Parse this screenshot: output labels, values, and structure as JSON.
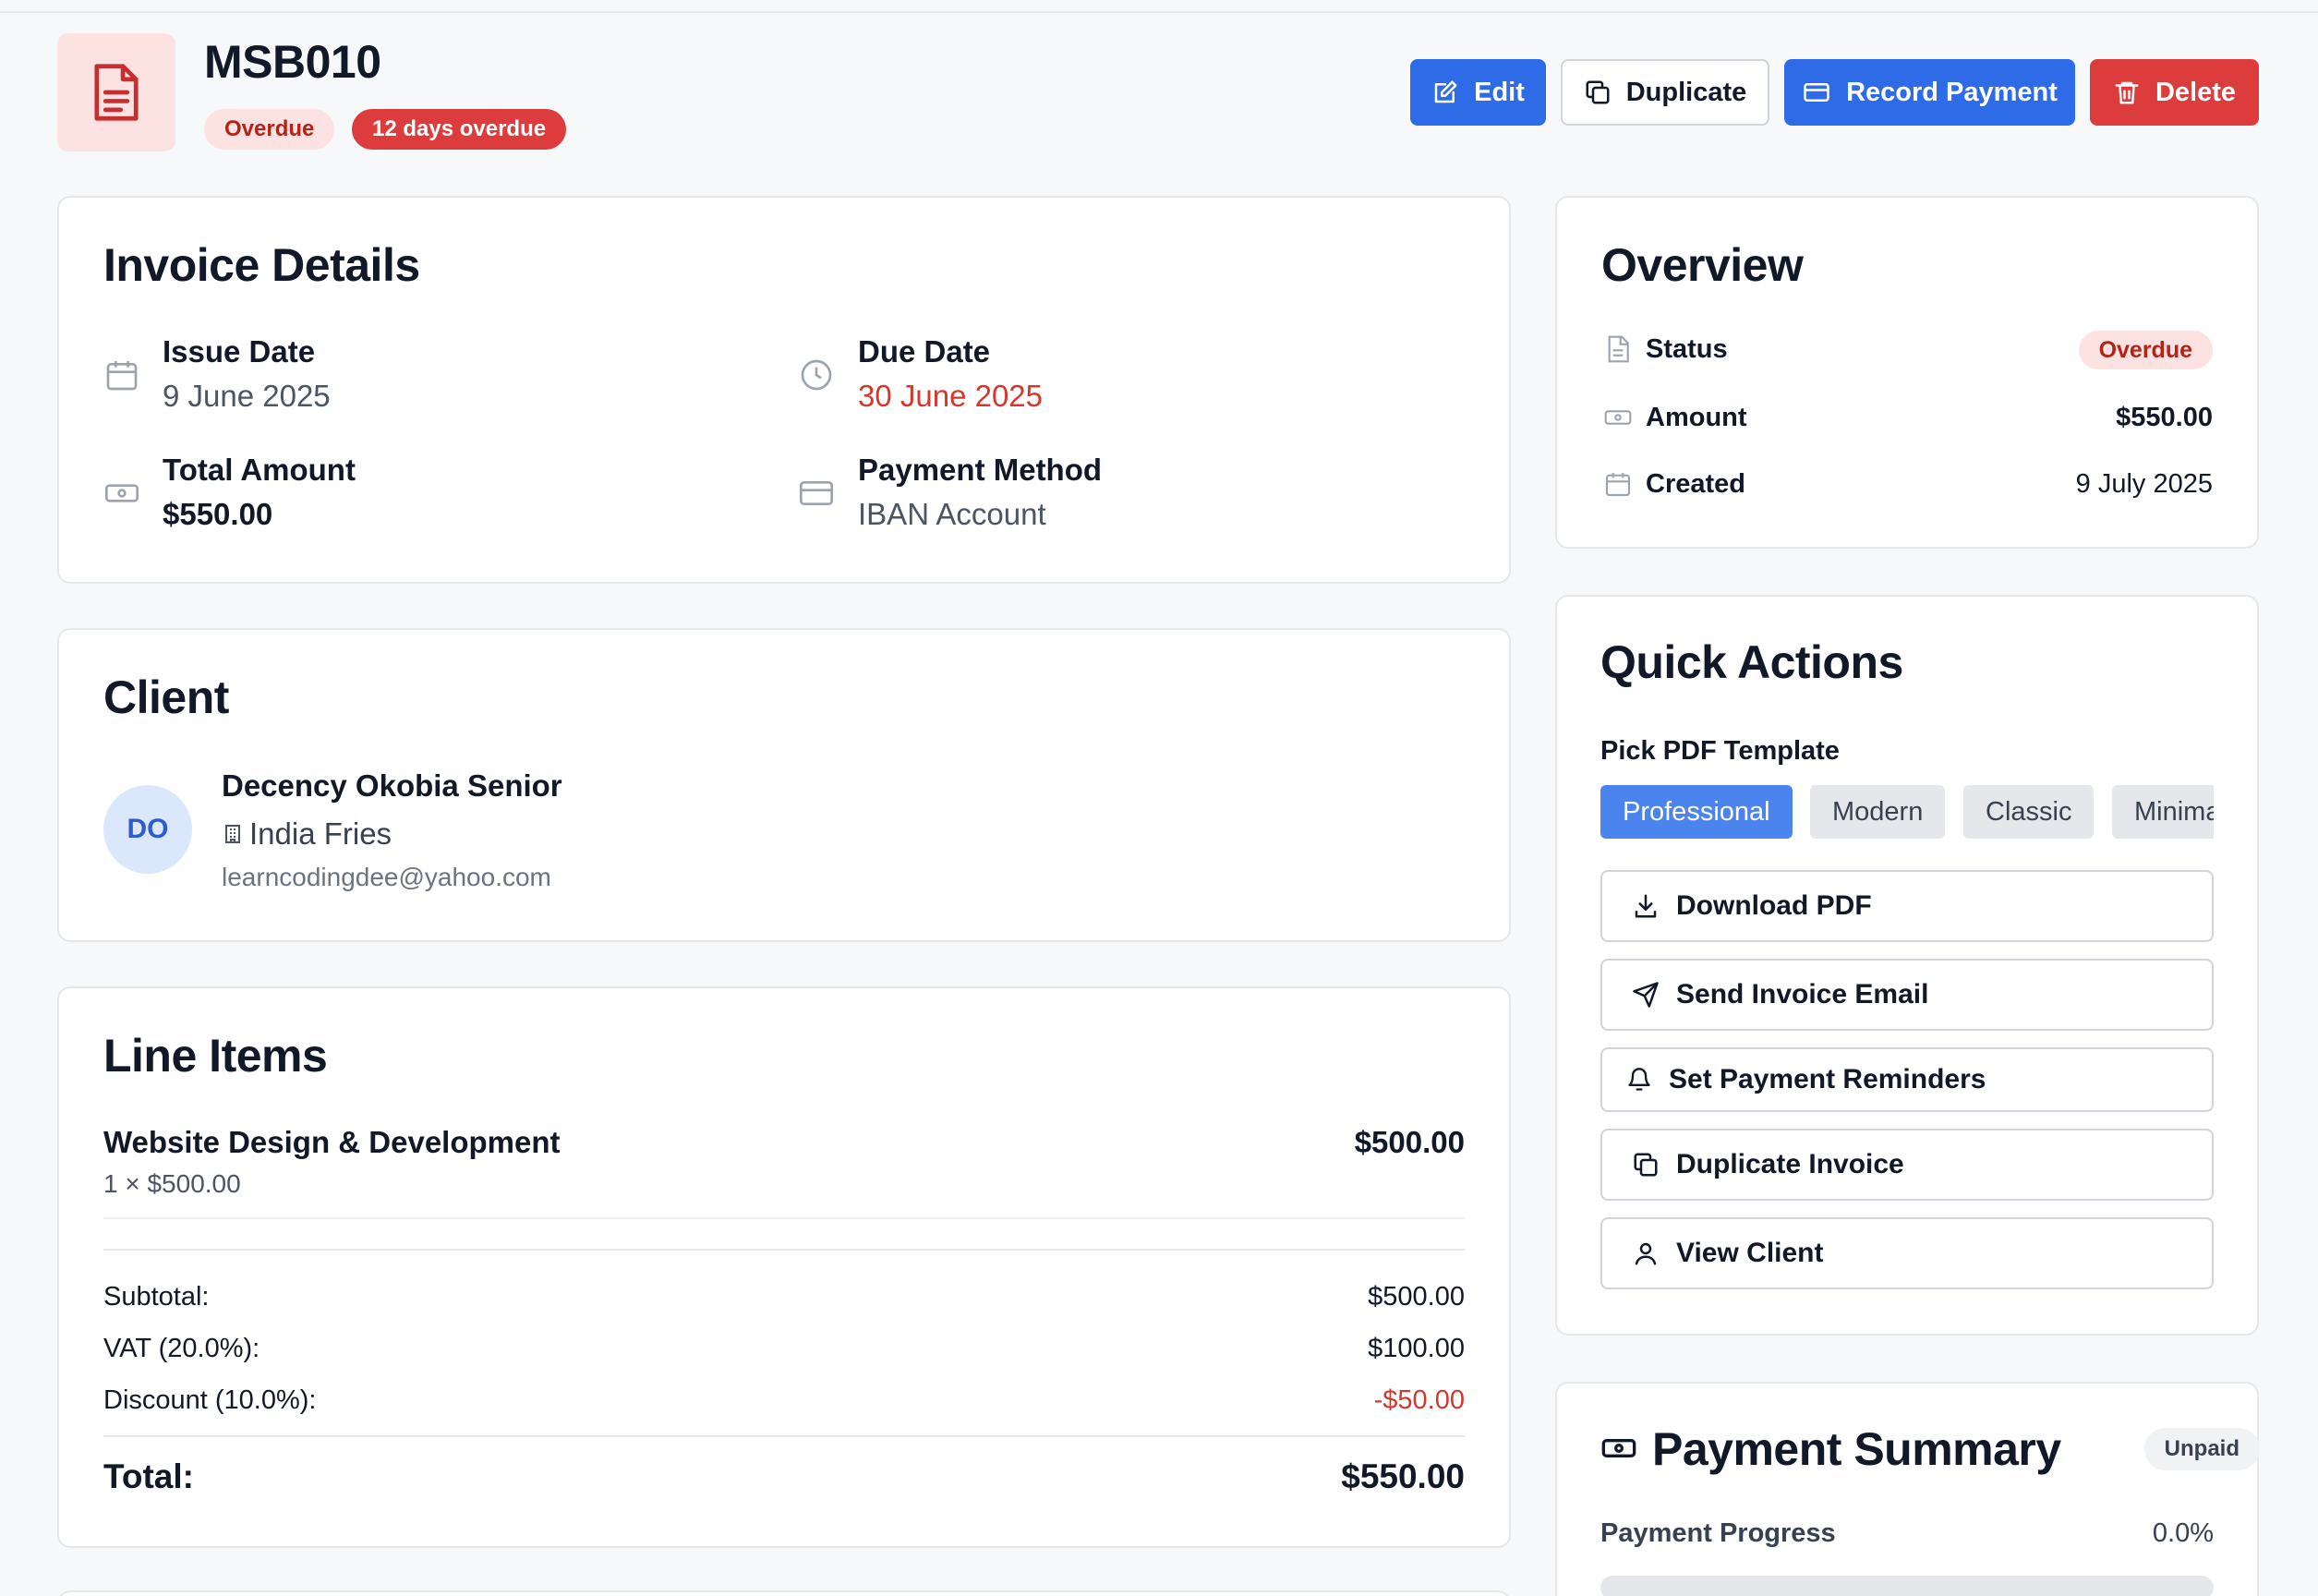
{
  "header": {
    "invoice_number": "MSB010",
    "status_badge": "Overdue",
    "overdue_badge": "12 days overdue",
    "actions": {
      "edit": "Edit",
      "duplicate": "Duplicate",
      "record_payment": "Record Payment",
      "delete": "Delete"
    }
  },
  "invoice_details": {
    "title": "Invoice Details",
    "issue_date_label": "Issue Date",
    "issue_date": "9 June 2025",
    "due_date_label": "Due Date",
    "due_date": "30 June 2025",
    "total_label": "Total Amount",
    "total": "$550.00",
    "payment_method_label": "Payment Method",
    "payment_method": "IBAN Account"
  },
  "client": {
    "title": "Client",
    "initials": "DO",
    "name": "Decency Okobia Senior",
    "company": "India Fries",
    "email": "learncodingdee@yahoo.com"
  },
  "line_items": {
    "title": "Line Items",
    "items": [
      {
        "description": "Website Design & Development",
        "qty_price": "1 × $500.00",
        "amount": "$500.00"
      }
    ],
    "subtotal_label": "Subtotal:",
    "subtotal": "$500.00",
    "vat_label": "VAT (20.0%):",
    "vat": "$100.00",
    "discount_label": "Discount (10.0%):",
    "discount": "-$50.00",
    "total_label": "Total:",
    "total": "$550.00"
  },
  "overview": {
    "title": "Overview",
    "status_label": "Status",
    "status": "Overdue",
    "amount_label": "Amount",
    "amount": "$550.00",
    "created_label": "Created",
    "created": "9 July 2025"
  },
  "quick_actions": {
    "title": "Quick Actions",
    "template_label": "Pick PDF Template",
    "templates": [
      "Professional",
      "Modern",
      "Classic",
      "Minimal"
    ],
    "selected_template": "Professional",
    "buttons": {
      "download_pdf": "Download PDF",
      "send_email": "Send Invoice Email",
      "reminders": "Set Payment Reminders",
      "duplicate": "Duplicate Invoice",
      "view_client": "View Client"
    }
  },
  "payment_summary": {
    "title": "Payment Summary",
    "badge": "Unpaid",
    "progress_label": "Payment Progress",
    "progress_text": "0.0%",
    "progress_fraction": 0.0
  },
  "colors": {
    "primary": "#2e6be6",
    "danger": "#dc3c3c",
    "overdue_bg": "#fde2e2",
    "overdue_text": "#b42318"
  }
}
